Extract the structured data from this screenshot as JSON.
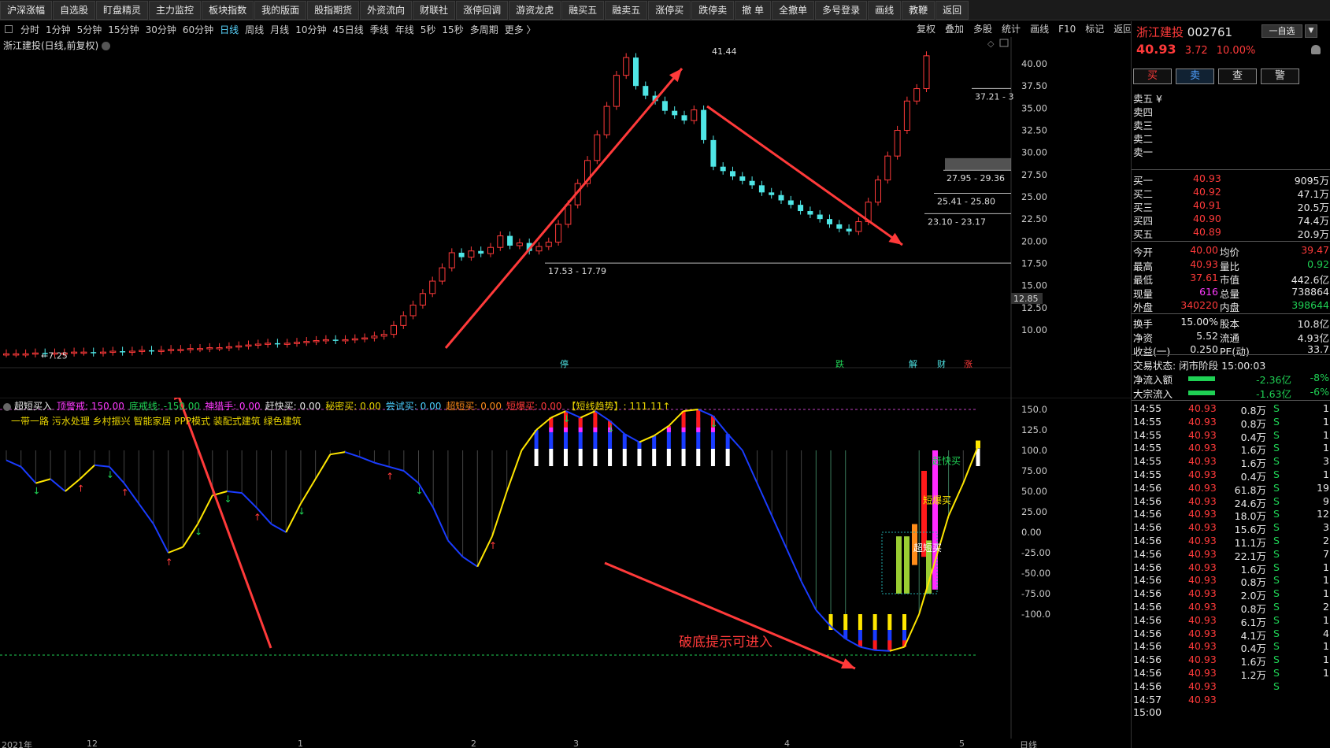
{
  "topbar": [
    "沪深涨幅",
    "自选股",
    "盯盘精灵",
    "主力监控",
    "板块指数",
    "我的版面",
    "股指期货",
    "外资流向",
    "财联社",
    "涨停回调",
    "游资龙虎",
    "融买五",
    "融卖五",
    "涨停买",
    "跌停卖",
    "撤 单",
    "全撤单",
    "多号登录",
    "画线",
    "教鞭",
    "返回"
  ],
  "periods": [
    "分时",
    "1分钟",
    "5分钟",
    "15分钟",
    "30分钟",
    "60分钟",
    "日线",
    "周线",
    "月线",
    "10分钟",
    "45日线",
    "季线",
    "年线",
    "5秒",
    "15秒",
    "多周期",
    "更多 〉"
  ],
  "active_period": "日线",
  "right_tools": [
    "复权",
    "叠加",
    "多股",
    "统计",
    "画线",
    "F10",
    "标记",
    "返回"
  ],
  "chart_title": "浙江建投(日线,前复权)",
  "price_axis": [
    "40.00",
    "37.50",
    "35.00",
    "32.50",
    "30.00",
    "27.50",
    "25.00",
    "22.50",
    "20.00",
    "17.50",
    "15.00",
    "12.50",
    "10.00"
  ],
  "price_marker": "12.85",
  "annotations": {
    "high": "41.44",
    "low": "7.25",
    "box1": "37.21 - 3",
    "box2": "27.95 - 29.36",
    "box3": "25.41 - 25.80",
    "box4": "23.10 - 23.17",
    "box5": "17.53 - 17.79"
  },
  "event_marks": [
    "停",
    "跌",
    "解",
    "财",
    "涨"
  ],
  "indicator": {
    "name": "超短买入",
    "params": [
      {
        "label": "顶警戒: 150.00",
        "color": "#ff3aff"
      },
      {
        "label": "底戒线: -150.00",
        "color": "#1fd154"
      },
      {
        "label": "神猎手: 0.00",
        "color": "#ff3aff"
      },
      {
        "label": "赶快买: 0.00",
        "color": "#e8e8e8"
      },
      {
        "label": "秘密买: 0.00",
        "color": "#e8d400"
      },
      {
        "label": "尝试买: 0.00",
        "color": "#4ad0ff"
      },
      {
        "label": "超短买: 0.00",
        "color": "#ff8c1a"
      },
      {
        "label": "短爆买: 0.00",
        "color": "#ff3a3a"
      },
      {
        "label": "【短线趋势】: 111.11↑",
        "color": "#e8d400"
      }
    ],
    "legend2": "一带一路  污水处理  乡村振兴  智能家居  PPP模式  装配式建筑  绿色建筑",
    "axis": [
      "150.0",
      "125.0",
      "100.0",
      "75.00",
      "50.00",
      "25.00",
      "0.00",
      "-25.00",
      "-50.00",
      "-75.00",
      "-100.0"
    ],
    "labels": {
      "kuai": "赶快买",
      "bao": "短爆买",
      "chao": "超短买"
    },
    "note": "破底提示可进入"
  },
  "x_axis": [
    "2021年",
    "12",
    "1",
    "2",
    "3",
    "4",
    "5"
  ],
  "x_axis_right": "日线",
  "quote": {
    "name": "浙江建投",
    "code": "002761",
    "tag": "一自选",
    "price": "40.93",
    "change": "3.72",
    "pct": "10.00%",
    "buttons": [
      "买",
      "卖",
      "查",
      "警"
    ],
    "sell": [
      {
        "label": "卖五 ¥"
      },
      {
        "label": "卖四"
      },
      {
        "label": "卖三"
      },
      {
        "label": "卖二"
      },
      {
        "label": "卖一"
      }
    ],
    "buy": [
      {
        "label": "买一",
        "price": "40.93",
        "vol": "9095万"
      },
      {
        "label": "买二",
        "price": "40.92",
        "vol": "47.1万"
      },
      {
        "label": "买三",
        "price": "40.91",
        "vol": "20.5万"
      },
      {
        "label": "买四",
        "price": "40.90",
        "vol": "74.4万"
      },
      {
        "label": "买五",
        "price": "40.89",
        "vol": "20.9万"
      }
    ],
    "stats": [
      {
        "l1": "今开",
        "v1": "40.00",
        "c1": "red",
        "l2": "均价",
        "v2": "39.47",
        "c2": "red"
      },
      {
        "l1": "最高",
        "v1": "40.93",
        "c1": "red",
        "l2": "量比",
        "v2": "0.92",
        "c2": "green"
      },
      {
        "l1": "最低",
        "v1": "37.61",
        "c1": "red",
        "l2": "市值",
        "v2": "442.6亿",
        "c2": "white"
      },
      {
        "l1": "现量",
        "v1": "616",
        "c1": "mag",
        "l2": "总量",
        "v2": "738864",
        "c2": "white"
      },
      {
        "l1": "外盘",
        "v1": "340220",
        "c1": "red",
        "l2": "内盘",
        "v2": "398644",
        "c2": "green"
      }
    ],
    "stats2": [
      {
        "l1": "换手",
        "v1": "15.00%",
        "l2": "股本",
        "v2": "10.8亿"
      },
      {
        "l1": "净资",
        "v1": "5.52",
        "l2": "流通",
        "v2": "4.93亿"
      },
      {
        "l1": "收益(一)",
        "v1": "0.250",
        "l2": "PE(动)",
        "v2": "33.7"
      }
    ],
    "status": "交易状态: 闭市阶段 15:00:03",
    "flows": [
      {
        "label": "净流入额",
        "v": "-2.36亿",
        "p": "-8%"
      },
      {
        "label": "大宗流入",
        "v": "-1.63亿",
        "p": "-6%"
      }
    ],
    "ticks": [
      [
        "14:55",
        "40.93",
        "0.8万",
        "S",
        "1"
      ],
      [
        "14:55",
        "40.93",
        "0.8万",
        "S",
        "1"
      ],
      [
        "14:55",
        "40.93",
        "0.4万",
        "S",
        "1"
      ],
      [
        "14:55",
        "40.93",
        "1.6万",
        "S",
        "1"
      ],
      [
        "14:55",
        "40.93",
        "1.6万",
        "S",
        "3"
      ],
      [
        "14:55",
        "40.93",
        "0.4万",
        "S",
        "1"
      ],
      [
        "14:56",
        "40.93",
        "61.8万",
        "S",
        "19"
      ],
      [
        "14:56",
        "40.93",
        "24.6万",
        "S",
        "9"
      ],
      [
        "14:56",
        "40.93",
        "18.0万",
        "S",
        "12"
      ],
      [
        "14:56",
        "40.93",
        "15.6万",
        "S",
        "3"
      ],
      [
        "14:56",
        "40.93",
        "11.1万",
        "S",
        "2"
      ],
      [
        "14:56",
        "40.93",
        "22.1万",
        "S",
        "7"
      ],
      [
        "14:56",
        "40.93",
        "1.6万",
        "S",
        "1"
      ],
      [
        "14:56",
        "40.93",
        "0.8万",
        "S",
        "1"
      ],
      [
        "14:56",
        "40.93",
        "2.0万",
        "S",
        "1"
      ],
      [
        "14:56",
        "40.93",
        "0.8万",
        "S",
        "2"
      ],
      [
        "14:56",
        "40.93",
        "6.1万",
        "S",
        "1"
      ],
      [
        "14:56",
        "40.93",
        "4.1万",
        "S",
        "4"
      ],
      [
        "14:56",
        "40.93",
        "0.4万",
        "S",
        "1"
      ],
      [
        "14:56",
        "40.93",
        "1.6万",
        "S",
        "1"
      ],
      [
        "14:56",
        "40.93",
        "1.2万",
        "S",
        "1"
      ],
      [
        "14:56",
        "40.93",
        "",
        "S",
        ""
      ],
      [
        "14:57",
        "40.93",
        "",
        "",
        ""
      ],
      [
        "15:00",
        "",
        "",
        " ",
        ""
      ]
    ]
  },
  "chart_data": {
    "type": "candlestick",
    "title": "浙江建投(日线,前复权)",
    "ylim": [
      10,
      40
    ],
    "candles": [
      7.3,
      7.3,
      7.3,
      7.4,
      7.3,
      7.4,
      7.4,
      7.5,
      7.5,
      7.4,
      7.5,
      7.6,
      7.5,
      7.6,
      7.7,
      7.6,
      7.7,
      7.8,
      7.8,
      7.9,
      7.9,
      8.0,
      8.0,
      8.1,
      8.2,
      8.3,
      8.4,
      8.5,
      8.4,
      8.5,
      8.6,
      8.7,
      8.8,
      8.9,
      8.8,
      8.9,
      9.0,
      9.1,
      9.3,
      9.5,
      10.5,
      11.6,
      12.8,
      14.1,
      15.5,
      17.0,
      18.7,
      18.2,
      18.9,
      18.6,
      19.3,
      20.6,
      19.5,
      19.8,
      18.9,
      19.4,
      19.9,
      21.9,
      24.1,
      26.5,
      29.1,
      32.0,
      35.2,
      38.7,
      40.7,
      37.5,
      36.4,
      35.8,
      34.7,
      34.2,
      33.6,
      34.8,
      31.4,
      28.4,
      27.9,
      27.3,
      26.8,
      26.3,
      25.5,
      25.2,
      24.6,
      24.1,
      23.4,
      23.0,
      22.5,
      21.9,
      21.4,
      21.1,
      22.2,
      24.4,
      26.9,
      29.6,
      32.5,
      35.8,
      37.2,
      40.9
    ]
  }
}
